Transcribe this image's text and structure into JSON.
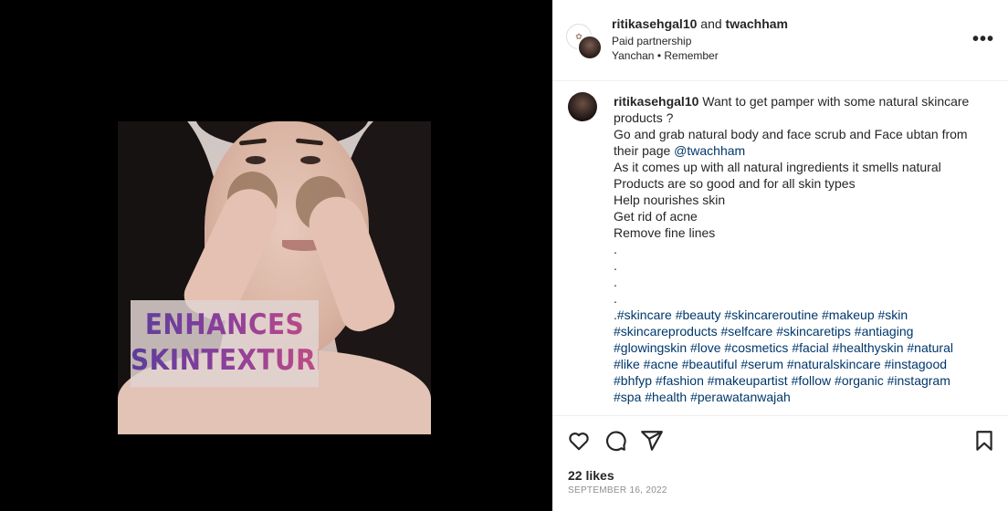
{
  "media": {
    "overlay_line1": "ENHANCES",
    "overlay_line2": "SKINTEXTURE",
    "overlay_colors": [
      "#5b3d9a",
      "#c14b84"
    ]
  },
  "header": {
    "user1": "ritikasehgal10",
    "and": "and",
    "user2": "twachham",
    "subtitle": "Paid partnership",
    "audio": "Yanchan • Remember",
    "more_label": "•••"
  },
  "caption": {
    "username": "ritikasehgal10",
    "line1_rest": "Want to get pamper with some natural skincare",
    "line2": "products ?",
    "line3": "Go and grab natural body and face scrub and Face ubtan from",
    "line4_pre": "their page",
    "line4_mention": "@twachham",
    "line5": "As it comes up with all natural ingredients it smells natural",
    "line6": "Products are so good and for all skin types",
    "line7": "Help nourishes skin",
    "line8": "Get rid of acne",
    "line9": "Remove fine lines",
    "dot": ".",
    "tags_prefix": ".",
    "tags": [
      "#skincare #beauty #skincareroutine #makeup #skin",
      "#skincareproducts #selfcare #skincaretips #antiaging",
      "#glowingskin #love #cosmetics #facial #healthyskin #natural",
      "#like #acne #beautiful #serum #naturalskincare #instagood",
      "#bhfyp #fashion #makeupartist #follow #organic #instagram",
      "#spa #health #perawatanwajah"
    ]
  },
  "actions": {
    "icons": [
      "heart-icon",
      "comment-icon",
      "share-icon",
      "bookmark-icon"
    ]
  },
  "likes": "22 likes",
  "date": "SEPTEMBER 16, 2022",
  "colors": {
    "link": "#00376b",
    "text": "#262626",
    "muted": "#8e8e8e"
  }
}
